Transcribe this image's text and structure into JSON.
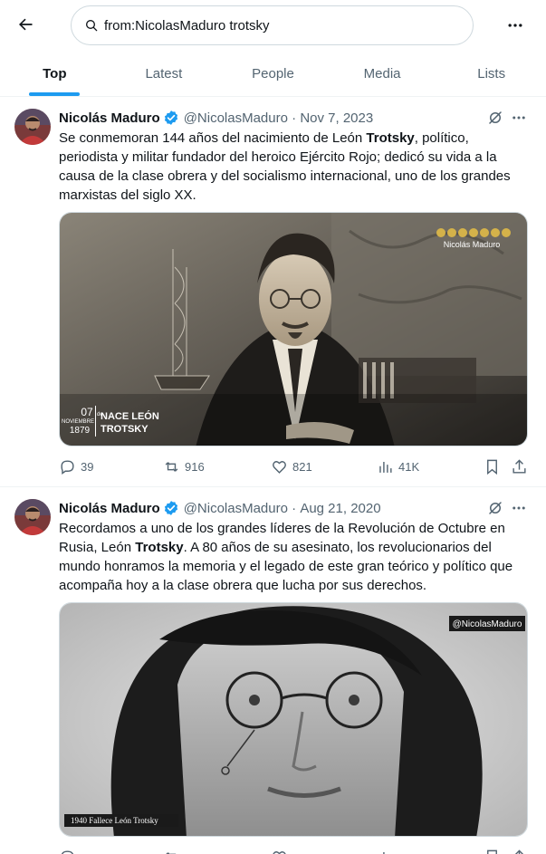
{
  "search": {
    "value": "from:NicolasMaduro trotsky"
  },
  "tabs": [
    {
      "label": "Top"
    },
    {
      "label": "Latest"
    },
    {
      "label": "People"
    },
    {
      "label": "Media"
    },
    {
      "label": "Lists"
    }
  ],
  "tweets": [
    {
      "name": "Nicolás Maduro",
      "handle": "@NicolasMaduro",
      "sep": " · ",
      "date": "Nov 7, 2023",
      "text_parts": [
        "Se conmemoran 144 años del nacimiento de León ",
        "Trotsky",
        ", político, periodista y militar fundador del heroico Ejército Rojo; dedicó su vida a la causa de la clase obrera y del socialismo internacional, uno de los grandes marxistas del siglo XX."
      ],
      "image": {
        "watermark": "Nicolás Maduro",
        "date_day": "07",
        "date_de": "de",
        "date_month": "NOVIEMBRE",
        "date_year": "1879",
        "caption_1": "NACE LEÓN",
        "caption_2": "TROTSKY"
      },
      "stats": {
        "replies": "39",
        "reposts": "916",
        "likes": "821",
        "views": "41K"
      }
    },
    {
      "name": "Nicolás Maduro",
      "handle": "@NicolasMaduro",
      "sep": " · ",
      "date": "Aug 21, 2020",
      "text_parts": [
        "Recordamos a uno de los grandes líderes de la Revolución de Octubre en Rusia, León ",
        "Trotsky",
        ". A 80 años de su asesinato, los revolucionarios del mundo honramos la memoria y el legado de este gran teórico y político que acompaña hoy a la clase obrera que lucha por sus derechos."
      ],
      "image": {
        "watermark": "@NicolasMaduro",
        "caption": "1940 Fallece León Trotsky"
      }
    }
  ],
  "icons": {
    "back": "arrow-left-icon",
    "search": "search-icon",
    "more": "more-horizontal-icon",
    "verified": "verified-badge-icon",
    "grok": "grok-icon",
    "reply": "reply-icon",
    "repost": "repost-icon",
    "like": "heart-icon",
    "views": "views-icon",
    "bookmark": "bookmark-icon",
    "share": "share-icon"
  },
  "colors": {
    "accent": "#1d9bf0",
    "text": "#0f1419",
    "muted": "#536471",
    "border": "#eff3f4"
  }
}
